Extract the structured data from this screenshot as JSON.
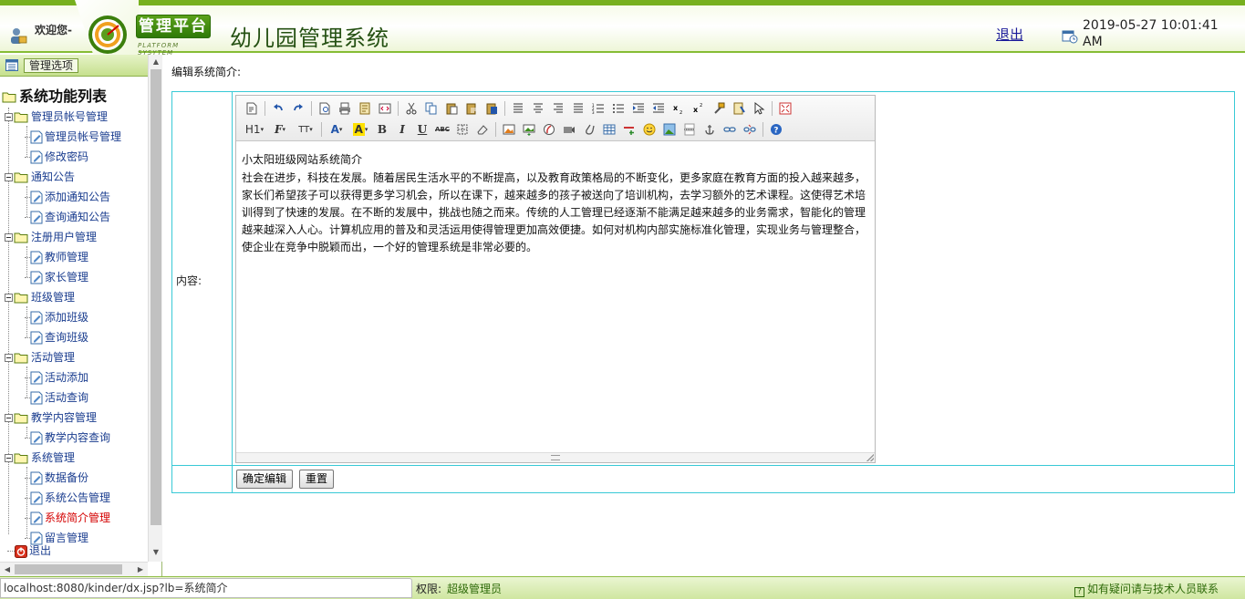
{
  "header": {
    "welcome": "欢迎您-",
    "platform_title": "管理平台",
    "platform_subtitle": "PLATFORM SYSYTEM",
    "system_title": "幼儿园管理系统",
    "logout": "退出",
    "datetime": "2019-05-27 10:01:41 AM"
  },
  "sidebar": {
    "options_label": "管理选项",
    "root": "系统功能列表",
    "groups": [
      {
        "label": "管理员帐号管理",
        "items": [
          "管理员帐号管理",
          "修改密码"
        ]
      },
      {
        "label": "通知公告",
        "items": [
          "添加通知公告",
          "查询通知公告"
        ]
      },
      {
        "label": "注册用户管理",
        "items": [
          "教师管理",
          "家长管理"
        ]
      },
      {
        "label": "班级管理",
        "items": [
          "添加班级",
          "查询班级"
        ]
      },
      {
        "label": "活动管理",
        "items": [
          "活动添加",
          "活动查询"
        ]
      },
      {
        "label": "教学内容管理",
        "items": [
          "教学内容查询"
        ]
      },
      {
        "label": "系统管理",
        "items": [
          "数据备份",
          "系统公告管理",
          "系统简介管理",
          "留言管理"
        ]
      }
    ],
    "logout": "退出",
    "active_item": "系统简介管理"
  },
  "main": {
    "heading": "编辑系统简介:",
    "content_label": "内容:",
    "editor": {
      "title": "小太阳班级网站系统简介",
      "body": "社会在进步，科技在发展。随着居民生活水平的不断提高，以及教育政策格局的不断变化，更多家庭在教育方面的投入越来越多，家长们希望孩子可以获得更多学习机会，所以在课下，越来越多的孩子被送向了培训机构，去学习额外的艺术课程。这使得艺术培训得到了快速的发展。在不断的发展中，挑战也随之而来。传统的人工管理已经逐渐不能满足越来越多的业务需求，智能化的管理越来越深入人心。计算机应用的普及和灵活运用使得管理更加高效便捷。如何对机构内部实施标准化管理，实现业务与管理整合，使企业在竞争中脱颖而出，一个好的管理系统是非常必要的。",
      "toolbar_row2_text": {
        "heading": "H1",
        "font": "F",
        "size": "TT",
        "bold": "B",
        "italic": "I",
        "underline": "U",
        "strike": "ABC"
      }
    },
    "confirm_button": "确定编辑",
    "reset_button": "重置"
  },
  "footer": {
    "status_url": "localhost:8080/kinder/dx.jsp?lb=系统简介",
    "perm_label": "权限:",
    "perm_value": "超级管理员",
    "help": "如有疑问请与技术人员联系"
  },
  "colors": {
    "brand_green": "#77b01e",
    "title_green": "#245012",
    "table_border": "#38c9d6",
    "active_item": "#d40000"
  }
}
